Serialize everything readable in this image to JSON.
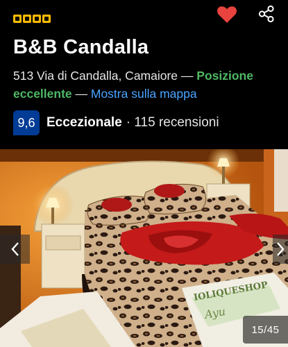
{
  "property": {
    "star_rating": 4,
    "name": "B&B Candalla",
    "address": "513 Via di Candalla, Camaiore",
    "dash1": " — ",
    "location_badge": "Posizione eccellente",
    "dash2": " — ",
    "map_link": "Mostra sulla mappa"
  },
  "review": {
    "score": "9,6",
    "label": "Eccezionale",
    "separator": " · ",
    "count_text": "115 recensioni"
  },
  "gallery": {
    "counter": "15/45",
    "current": 15,
    "total": 45
  },
  "colors": {
    "star": "#feba02",
    "favorite": "#e8433e",
    "score_bg": "#003b95",
    "positive": "#4fb765",
    "link": "#4aa4ff"
  },
  "icons": {
    "favorite": "heart-icon",
    "share": "share-icon",
    "prev": "chevron-left-icon",
    "next": "chevron-right-icon"
  }
}
